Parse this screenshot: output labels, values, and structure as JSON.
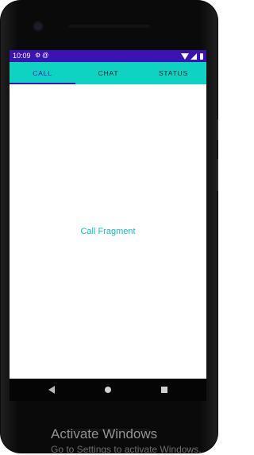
{
  "status_bar": {
    "time": "10:09",
    "left_icons": [
      "gear-icon",
      "at-icon"
    ],
    "right_icons": [
      "wifi-icon",
      "signal-icon",
      "battery-icon"
    ],
    "color": "#3b12b3"
  },
  "tabs": [
    {
      "label": "CALL",
      "active": true
    },
    {
      "label": "CHAT",
      "active": false
    },
    {
      "label": "STATUS",
      "active": false
    }
  ],
  "tab_bar_color": "#0fd3c2",
  "content": {
    "label": "Call Fragment"
  },
  "nav_bar": {
    "buttons": [
      "back-icon",
      "home-icon",
      "recents-icon"
    ]
  },
  "watermark": {
    "title": "Activate Windows",
    "subtitle": "Go to Settings to activate Windows."
  }
}
